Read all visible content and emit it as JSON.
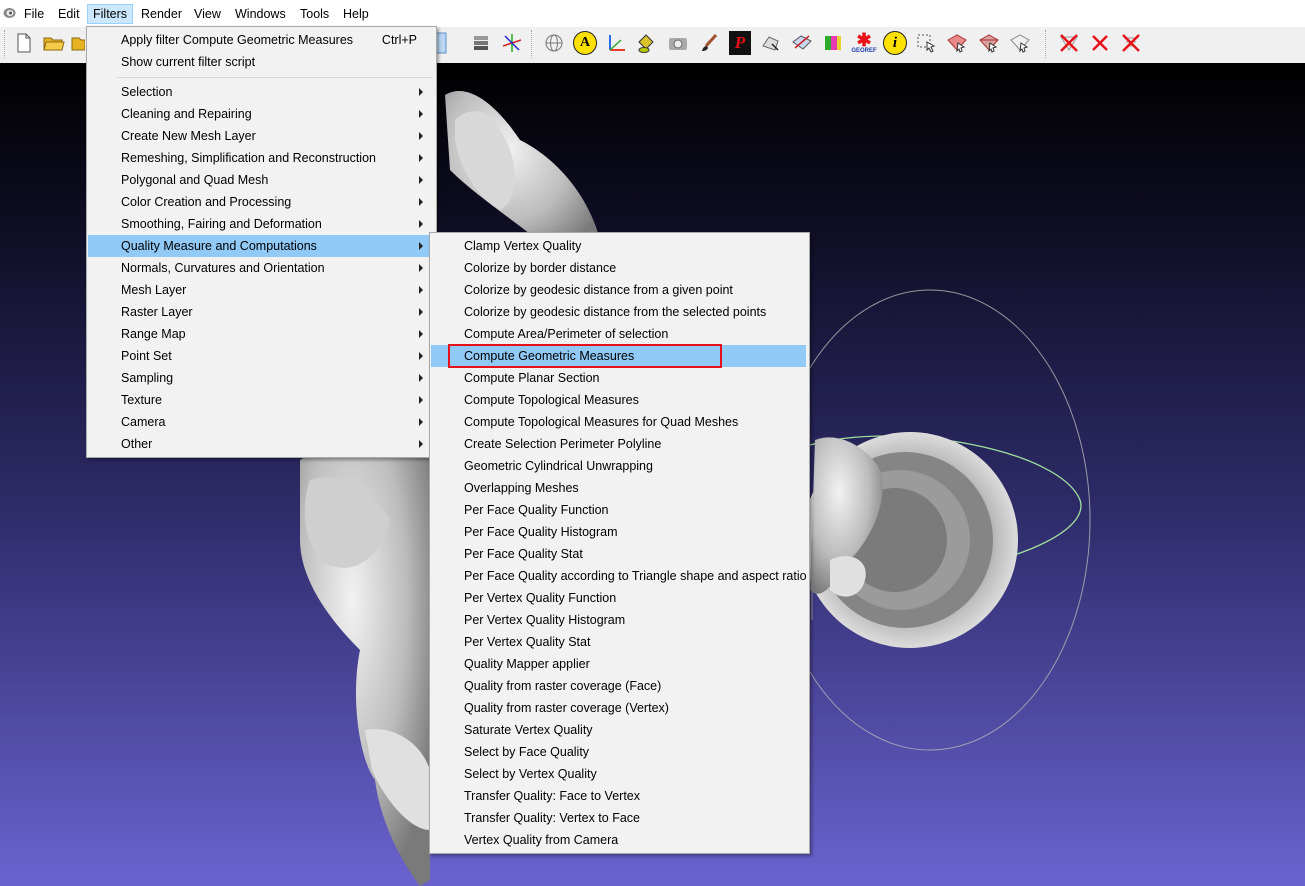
{
  "menubar": {
    "items": [
      {
        "label": "File",
        "name": "menu-file"
      },
      {
        "label": "Edit",
        "name": "menu-edit"
      },
      {
        "label": "Filters",
        "name": "menu-filters"
      },
      {
        "label": "Render",
        "name": "menu-render"
      },
      {
        "label": "View",
        "name": "menu-view"
      },
      {
        "label": "Windows",
        "name": "menu-windows"
      },
      {
        "label": "Tools",
        "name": "menu-tools"
      },
      {
        "label": "Help",
        "name": "menu-help"
      }
    ]
  },
  "toolbar": {
    "texts": {
      "a_label": "A",
      "info_label": "i",
      "georef_label": "GEOREF",
      "p_label": "P"
    }
  },
  "filters_menu": {
    "top_items": [
      {
        "label": "Apply filter Compute Geometric Measures",
        "shortcut": "Ctrl+P"
      },
      {
        "label": "Show current filter script",
        "shortcut": ""
      }
    ],
    "categories": [
      "Selection",
      "Cleaning and Repairing",
      "Create New Mesh Layer",
      "Remeshing, Simplification and Reconstruction",
      "Polygonal and Quad Mesh",
      "Color Creation and Processing",
      "Smoothing, Fairing and Deformation",
      "Quality Measure and Computations",
      "Normals, Curvatures and Orientation",
      "Mesh Layer",
      "Raster Layer",
      "Range Map",
      "Point Set",
      "Sampling",
      "Texture",
      "Camera",
      "Other"
    ],
    "highlighted_category": "Quality Measure and Computations"
  },
  "quality_submenu": {
    "items": [
      "Clamp Vertex Quality",
      "Colorize by border distance",
      "Colorize by geodesic distance from a given point",
      "Colorize by geodesic distance from the selected points",
      "Compute Area/Perimeter of selection",
      "Compute Geometric Measures",
      "Compute Planar Section",
      "Compute Topological Measures",
      "Compute Topological Measures for Quad Meshes",
      "Create Selection Perimeter Polyline",
      "Geometric Cylindrical Unwrapping",
      "Overlapping Meshes",
      "Per Face Quality Function",
      "Per Face Quality Histogram",
      "Per Face Quality Stat",
      "Per Face Quality according to Triangle shape and aspect ratio",
      "Per Vertex Quality Function",
      "Per Vertex Quality Histogram",
      "Per Vertex Quality Stat",
      "Quality Mapper applier",
      "Quality from raster coverage (Face)",
      "Quality from raster coverage (Vertex)",
      "Saturate Vertex Quality",
      "Select by Face Quality",
      "Select by Vertex Quality",
      "Transfer Quality: Face to Vertex",
      "Transfer Quality: Vertex to Face",
      "Vertex Quality from Camera"
    ],
    "highlighted_item": "Compute Geometric Measures"
  },
  "colors": {
    "menu_highlight": "#91c9f7",
    "annotation_box": "#e8111a",
    "viewport_top": "#000000",
    "viewport_bottom": "#6a63cf"
  }
}
